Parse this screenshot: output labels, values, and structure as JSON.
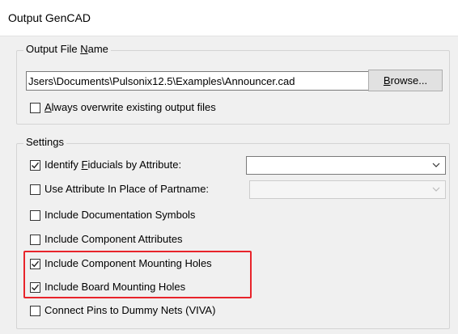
{
  "window": {
    "title": "Output GenCAD"
  },
  "output_file": {
    "group_label_pre": "Output File ",
    "group_label_key": "N",
    "group_label_post": "ame",
    "path": "Jsers\\Documents\\Pulsonix12.5\\Examples\\Announcer.cad",
    "browse_key": "B",
    "browse_rest": "rowse...",
    "overwrite": {
      "key": "A",
      "rest": "lways overwrite existing output files",
      "checked": false
    }
  },
  "settings": {
    "group_label": "Settings",
    "identify": {
      "pre": "Identify ",
      "key": "F",
      "rest": "iducials by Attribute:",
      "checked": true,
      "value": ""
    },
    "use_attr": {
      "label": "Use Attribute In Place of Partname:",
      "checked": false,
      "value": ""
    },
    "doc_symbols": {
      "label": "Include Documentation Symbols",
      "checked": false
    },
    "comp_attrs": {
      "label": "Include Component Attributes",
      "checked": false
    },
    "comp_holes": {
      "label": "Include Component Mounting Holes",
      "checked": true
    },
    "board_holes": {
      "label": "Include Board Mounting Holes",
      "checked": true
    },
    "connect_pins": {
      "label": "Connect Pins to Dummy Nets (VIVA)",
      "checked": false
    }
  },
  "icons": {
    "check": "checkmark-icon",
    "dropdown": "chevron-down-icon"
  },
  "colors": {
    "highlight": "#e8242b",
    "background": "#f0f0f0"
  }
}
